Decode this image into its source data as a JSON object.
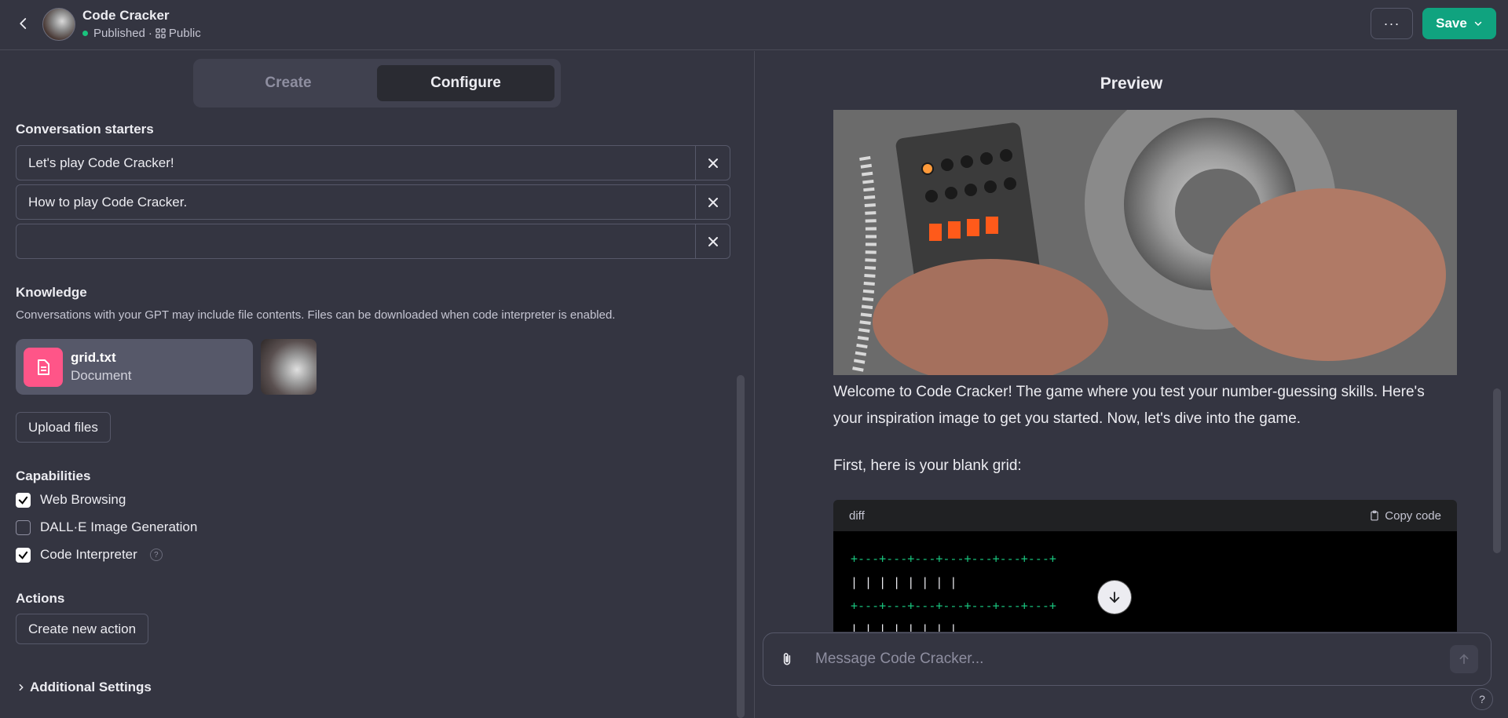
{
  "header": {
    "title": "Code Cracker",
    "status": "Published",
    "separator": "·",
    "visibility": "Public",
    "more_label": "···",
    "save_label": "Save"
  },
  "tabs": [
    {
      "label": "Create",
      "active": false
    },
    {
      "label": "Configure",
      "active": true
    }
  ],
  "conversation_starters": {
    "title": "Conversation starters",
    "items": [
      "Let's play Code Cracker!",
      "How to play Code Cracker.",
      ""
    ]
  },
  "knowledge": {
    "title": "Knowledge",
    "description": "Conversations with your GPT may include file contents. Files can be downloaded when code interpreter is enabled.",
    "files": [
      {
        "name": "grid.txt",
        "type": "Document"
      }
    ],
    "upload_label": "Upload files"
  },
  "capabilities": {
    "title": "Capabilities",
    "items": [
      {
        "label": "Web Browsing",
        "checked": true
      },
      {
        "label": "DALL·E Image Generation",
        "checked": false
      },
      {
        "label": "Code Interpreter",
        "checked": true
      }
    ],
    "help_glyph": "?"
  },
  "actions": {
    "title": "Actions",
    "create_label": "Create new action"
  },
  "additional_settings": "Additional Settings",
  "preview": {
    "title": "Preview",
    "welcome": "Welcome to Code Cracker! The game where you test your number-guessing skills. Here's your inspiration image to get you started. Now, let's dive into the game.",
    "grid_intro": "First, here is your blank grid:",
    "code_lang": "diff",
    "copy_label": "Copy code",
    "code_lines": [
      "+---+---+---+---+---+---+---+",
      "|   |   |   |   |   |   |   |",
      "+---+---+---+---+---+---+---+",
      "|   |   |   |   |   |   |   |"
    ],
    "composer_placeholder": "Message Code Cracker...",
    "help_label": "?"
  },
  "colors": {
    "background": "#343541",
    "accent": "#10a37f",
    "file_icon": "#ff5588",
    "code_green": "#19c37d"
  }
}
